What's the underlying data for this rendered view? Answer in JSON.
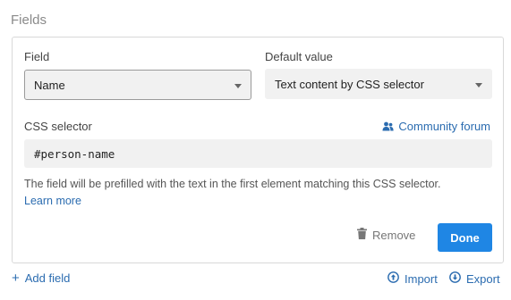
{
  "section": {
    "title": "Fields"
  },
  "field_editor": {
    "field_label": "Field",
    "field_value": "Name",
    "default_label": "Default value",
    "default_value": "Text content by CSS selector",
    "css_selector_label": "CSS selector",
    "community_link": "Community forum",
    "css_selector_value": "#person-name",
    "help_text": "The field will be prefilled with the text in the first element matching this CSS selector.",
    "learn_more": "Learn more",
    "remove_label": "Remove",
    "done_label": "Done"
  },
  "footer": {
    "add_field": "Add field",
    "import": "Import",
    "export": "Export"
  },
  "colors": {
    "accent": "#1f86e4",
    "link": "#2b6cb0"
  }
}
